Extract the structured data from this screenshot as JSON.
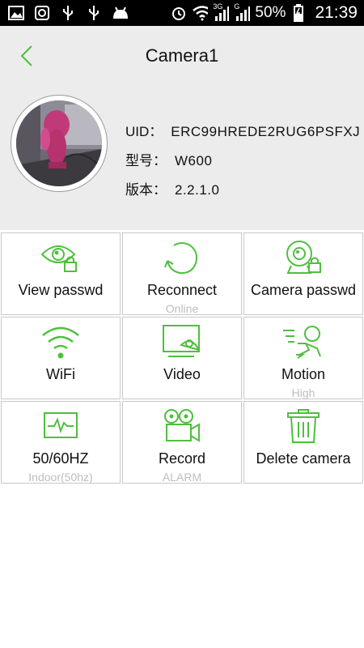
{
  "status_bar": {
    "battery": "50%",
    "time": "21:39",
    "net_3g": "3G",
    "net_g": "G",
    "icons": [
      "image-icon",
      "sync-icon",
      "usb-icon",
      "usb-icon",
      "android-icon",
      "alarm-icon",
      "wifi-icon",
      "signal-icon",
      "signal-icon",
      "battery-icon"
    ]
  },
  "header": {
    "back_icon": "chevron-left-icon",
    "title": "Camera1",
    "uid_label": "UID：",
    "uid_value": "ERC99HREDE2RUG6PSFXJ",
    "model_label": "型号：",
    "model_value": "W600",
    "version_label": "版本：",
    "version_value": "2.2.1.0"
  },
  "grid": {
    "items": [
      {
        "label": "View passwd",
        "sub": "",
        "icon": "eye-lock-icon"
      },
      {
        "label": "Reconnect",
        "sub": "Online",
        "icon": "refresh-icon"
      },
      {
        "label": "Camera passwd",
        "sub": "",
        "icon": "webcam-lock-icon"
      },
      {
        "label": "WiFi",
        "sub": "",
        "icon": "wifi-icon"
      },
      {
        "label": "Video",
        "sub": "",
        "icon": "video-screen-icon"
      },
      {
        "label": "Motion",
        "sub": "High",
        "icon": "motion-icon"
      },
      {
        "label": "50/60HZ",
        "sub": "Indoor(50hz)",
        "icon": "waveform-icon"
      },
      {
        "label": "Record",
        "sub": "ALARM",
        "icon": "movie-camera-icon"
      },
      {
        "label": "Delete camera",
        "sub": "",
        "icon": "trash-icon"
      }
    ]
  },
  "colors": {
    "accent": "#4fbf3e",
    "header_bg": "#ececec",
    "grid_border": "#c9c9c9",
    "sub_text": "#bdbdbd"
  }
}
